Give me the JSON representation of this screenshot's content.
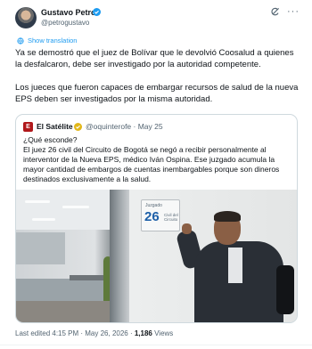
{
  "author": {
    "name": "Gustavo Petro",
    "handle": "@petrogustavo"
  },
  "actions": {
    "grok_icon": "grok-icon",
    "more": "···"
  },
  "translate_label": "Show translation",
  "tweet": {
    "paragraph1": "Ya se demostró que el juez de Bolívar que le devolvió Coosalud a quienes la desfalcaron, debe ser investigado por la autoridad competente.",
    "paragraph2": "Los jueces que fueron capaces de embargar recursos de salud de la nueva EPS deben ser investigados por la misma autoridad."
  },
  "quote": {
    "avatar_letter": "E",
    "author_name": "El Satélite",
    "handle_date": "@oquinterofe · May 25",
    "line1": "¿Qué esconde?",
    "line2": "El juez 26 civil del Circuito de Bogotá se negó a recibir personalmente al interventor de la Nueva EPS, médico Iván Ospina. Ese juzgado acumula la mayor cantidad de embargos de cuentas inembargables porque son dineros destinados exclusivamente a la salud.",
    "sign": {
      "top": "Juzgado",
      "number": "26",
      "side": "Civil del Circuito"
    }
  },
  "meta": {
    "edited": "Last edited 4:15 PM · May 26, 2026 · ",
    "views": "1,186",
    "views_label": " Views"
  },
  "colors": {
    "accent": "#1d9bf0",
    "text": "#0f1419",
    "muted": "#536471",
    "border": "#cfd9de"
  }
}
